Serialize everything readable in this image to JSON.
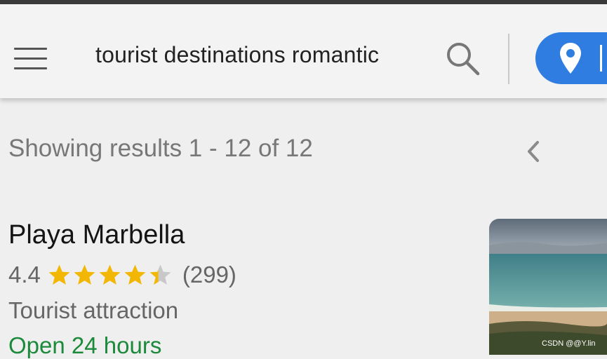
{
  "search": {
    "query": "tourist destinations romantic"
  },
  "results_header": {
    "summary": "Showing results 1 - 12 of 12"
  },
  "place": {
    "name": "Playa Marbella",
    "rating": "4.4",
    "rating_value": 4.4,
    "rating_max": 5,
    "reviews": "(299)",
    "category": "Tourist attraction",
    "hours": "Open 24 hours"
  },
  "watermark": "CSDN @@Y.lin",
  "icons": [
    "menu-icon",
    "search-icon",
    "location-pin-icon",
    "chevron-left-icon",
    "star-icon"
  ],
  "colors": {
    "accent": "#2f7de1",
    "star": "#f2b705",
    "star_empty": "#c8c8c8",
    "open_status": "#1b8a3a"
  }
}
